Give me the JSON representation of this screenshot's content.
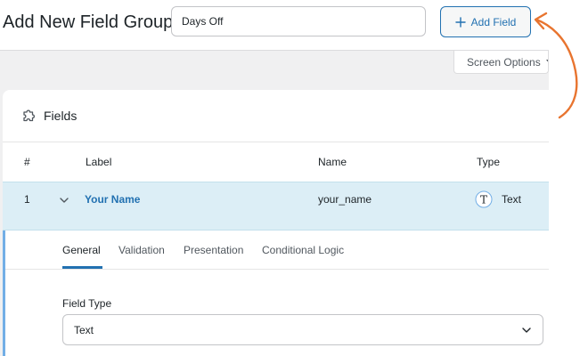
{
  "header": {
    "title": "Add New Field Group",
    "group_title_value": "Days Off",
    "add_field_label": "Add Field",
    "screen_options_label": "Screen Options"
  },
  "fields_panel": {
    "title": "Fields",
    "columns": [
      "#",
      "Label",
      "Name",
      "Type"
    ],
    "rows": [
      {
        "order": "1",
        "label": "Your Name",
        "name": "your_name",
        "type": "Text",
        "type_icon_letter": "T"
      }
    ]
  },
  "field_settings": {
    "tabs": [
      {
        "label": "General",
        "active": true
      },
      {
        "label": "Validation",
        "active": false
      },
      {
        "label": "Presentation",
        "active": false
      },
      {
        "label": "Conditional Logic",
        "active": false
      }
    ],
    "field_type_label": "Field Type",
    "field_type_value": "Text"
  },
  "colors": {
    "accent": "#2271b1",
    "annotation_arrow": "#e8742f",
    "selected_row": "#dceef6"
  }
}
